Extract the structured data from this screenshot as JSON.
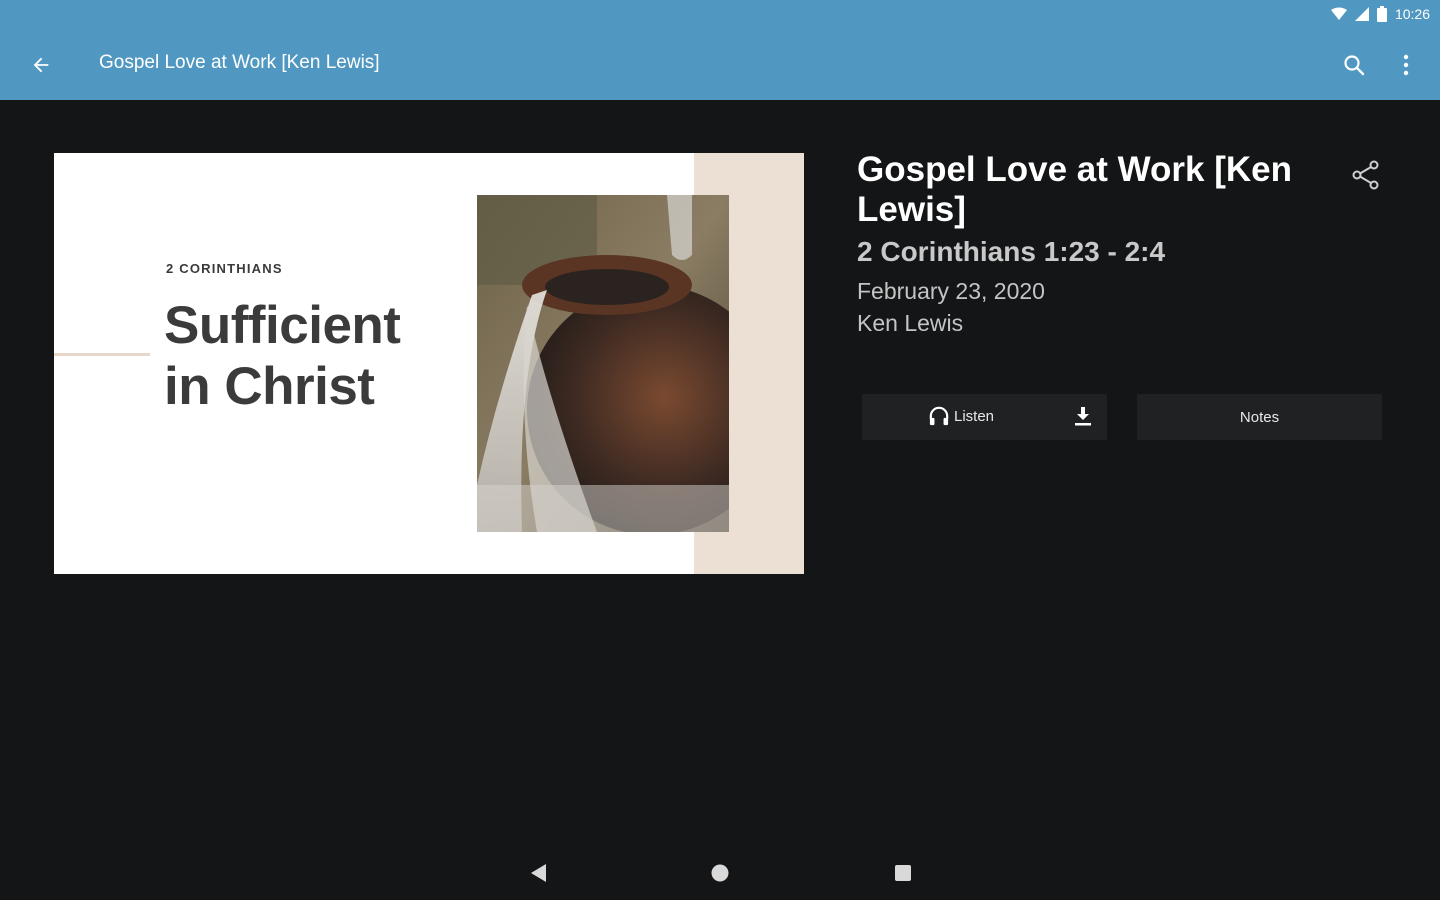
{
  "status": {
    "time": "10:26"
  },
  "app_bar": {
    "title": "Gospel Love at Work [Ken Lewis]"
  },
  "artwork": {
    "kicker": "2 CORINTHIANS",
    "title_line1": "Sufficient",
    "title_line2": "in Christ"
  },
  "sermon": {
    "title": "Gospel Love at Work [Ken Lewis]",
    "reference": "2 Corinthians 1:23 - 2:4",
    "date": "February 23, 2020",
    "speaker": "Ken Lewis"
  },
  "actions": {
    "listen_label": "Listen",
    "notes_label": "Notes"
  },
  "icons": [
    "arrow-back-icon",
    "search-icon",
    "more-vert-icon",
    "share-icon",
    "headphones-icon",
    "download-icon",
    "wifi-icon",
    "signal-icon",
    "battery-icon"
  ],
  "colors": {
    "app_bar": "#5098c2",
    "background": "#141517",
    "button": "#202123"
  }
}
